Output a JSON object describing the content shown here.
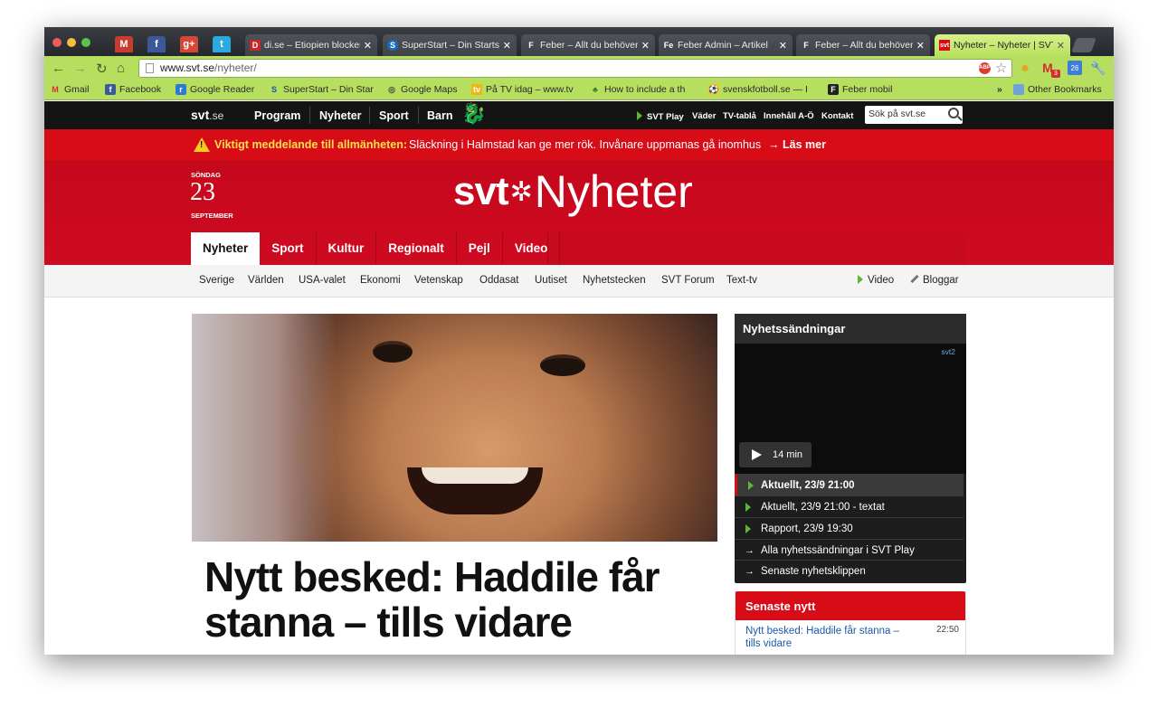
{
  "browser": {
    "tabs": [
      {
        "title": "di.se – Etiopien blocker",
        "favicon": "D"
      },
      {
        "title": "SuperStart – Din Startsi",
        "favicon": "S"
      },
      {
        "title": "Feber – Allt du behöver",
        "favicon": "F"
      },
      {
        "title": "Feber Admin – Artikel",
        "favicon": "Fe"
      },
      {
        "title": "Feber – Allt du behöver",
        "favicon": "F"
      },
      {
        "title": "Nyheter – Nyheter | SVT",
        "favicon": "svt"
      }
    ],
    "pinned_tabs": [
      "gmail-icon",
      "facebook-icon",
      "google-plus-icon",
      "twitter-icon"
    ],
    "url_host": "www.svt.se",
    "url_path": "/nyheter/",
    "extensions": [
      "adblock-icon",
      "star-icon",
      "extension-icon",
      "gmail-icon",
      "calendar-icon",
      "wrench-icon"
    ],
    "gmail_badge": "3",
    "calendar_badge": "26",
    "bookmarks": [
      {
        "label": "Gmail",
        "icon": "gmail-icon"
      },
      {
        "label": "Facebook",
        "icon": "facebook-icon"
      },
      {
        "label": "Google Reader",
        "icon": "reader-icon"
      },
      {
        "label": "SuperStart – Din Star",
        "icon": "superstart-icon"
      },
      {
        "label": "Google Maps",
        "icon": "maps-icon"
      },
      {
        "label": "På TV idag – www.tv",
        "icon": "tv-icon"
      },
      {
        "label": "How to include a th",
        "icon": "tree-icon"
      },
      {
        "label": "svenskfotboll.se — I",
        "icon": "football-icon"
      },
      {
        "label": "Feber mobil",
        "icon": "feber-icon"
      }
    ],
    "bookmarks_overflow": "»",
    "other_bookmarks": "Other Bookmarks"
  },
  "site": {
    "logo": {
      "text": "svt",
      "suffix": ".se"
    },
    "topnav": [
      "Program",
      "Nyheter",
      "Sport",
      "Barn"
    ],
    "rightnav": [
      "SVT Play",
      "Väder",
      "TV-tablå",
      "Innehåll A-Ö",
      "Kontakt"
    ],
    "search_placeholder": "Sök på svt.se",
    "alert": {
      "label": "Viktigt meddelande till allmänheten:",
      "message": "Släckning i Halmstad kan ge mer rök. Invånare uppmanas gå inomhus",
      "link": "Läs mer"
    },
    "date": {
      "weekday": "SÖNDAG",
      "day": "23",
      "month": "SEPTEMBER"
    },
    "brand": {
      "svt": "svt",
      "name": "Nyheter"
    },
    "section_tabs": [
      "Nyheter",
      "Sport",
      "Kultur",
      "Regionalt",
      "Pejl",
      "Video"
    ],
    "subnav": [
      "Sverige",
      "Världen",
      "USA-valet",
      "Ekonomi",
      "Vetenskap",
      "Oddasat",
      "Uutiset",
      "Nyhetstecken",
      "SVT Forum",
      "Text-tv"
    ],
    "subnav_right": [
      "Video",
      "Bloggar"
    ]
  },
  "article": {
    "headline": "Nytt besked: Haddile får stanna – tills vidare"
  },
  "newscasts": {
    "title": "Nyhetssändningar",
    "channel": "svt2",
    "duration": "14 min",
    "items": [
      {
        "label": "Aktuellt, 23/9 21:00",
        "kind": "video",
        "active": true
      },
      {
        "label": "Aktuellt, 23/9 21:00 - textat",
        "kind": "video"
      },
      {
        "label": "Rapport, 23/9 19:30",
        "kind": "video"
      },
      {
        "label": "Alla nyhetssändningar i SVT Play",
        "kind": "link"
      },
      {
        "label": "Senaste nyhetsklippen",
        "kind": "link"
      }
    ]
  },
  "latest": {
    "title": "Senaste nytt",
    "items": [
      {
        "text": "Nytt besked: Haddile får stanna – tills vidare",
        "time": "22:50"
      }
    ]
  },
  "colors": {
    "svt_red": "#d70c16",
    "chrome_green": "#b7df5f",
    "dark_bar": "#141414",
    "alert_yellow": "#fde04a"
  }
}
